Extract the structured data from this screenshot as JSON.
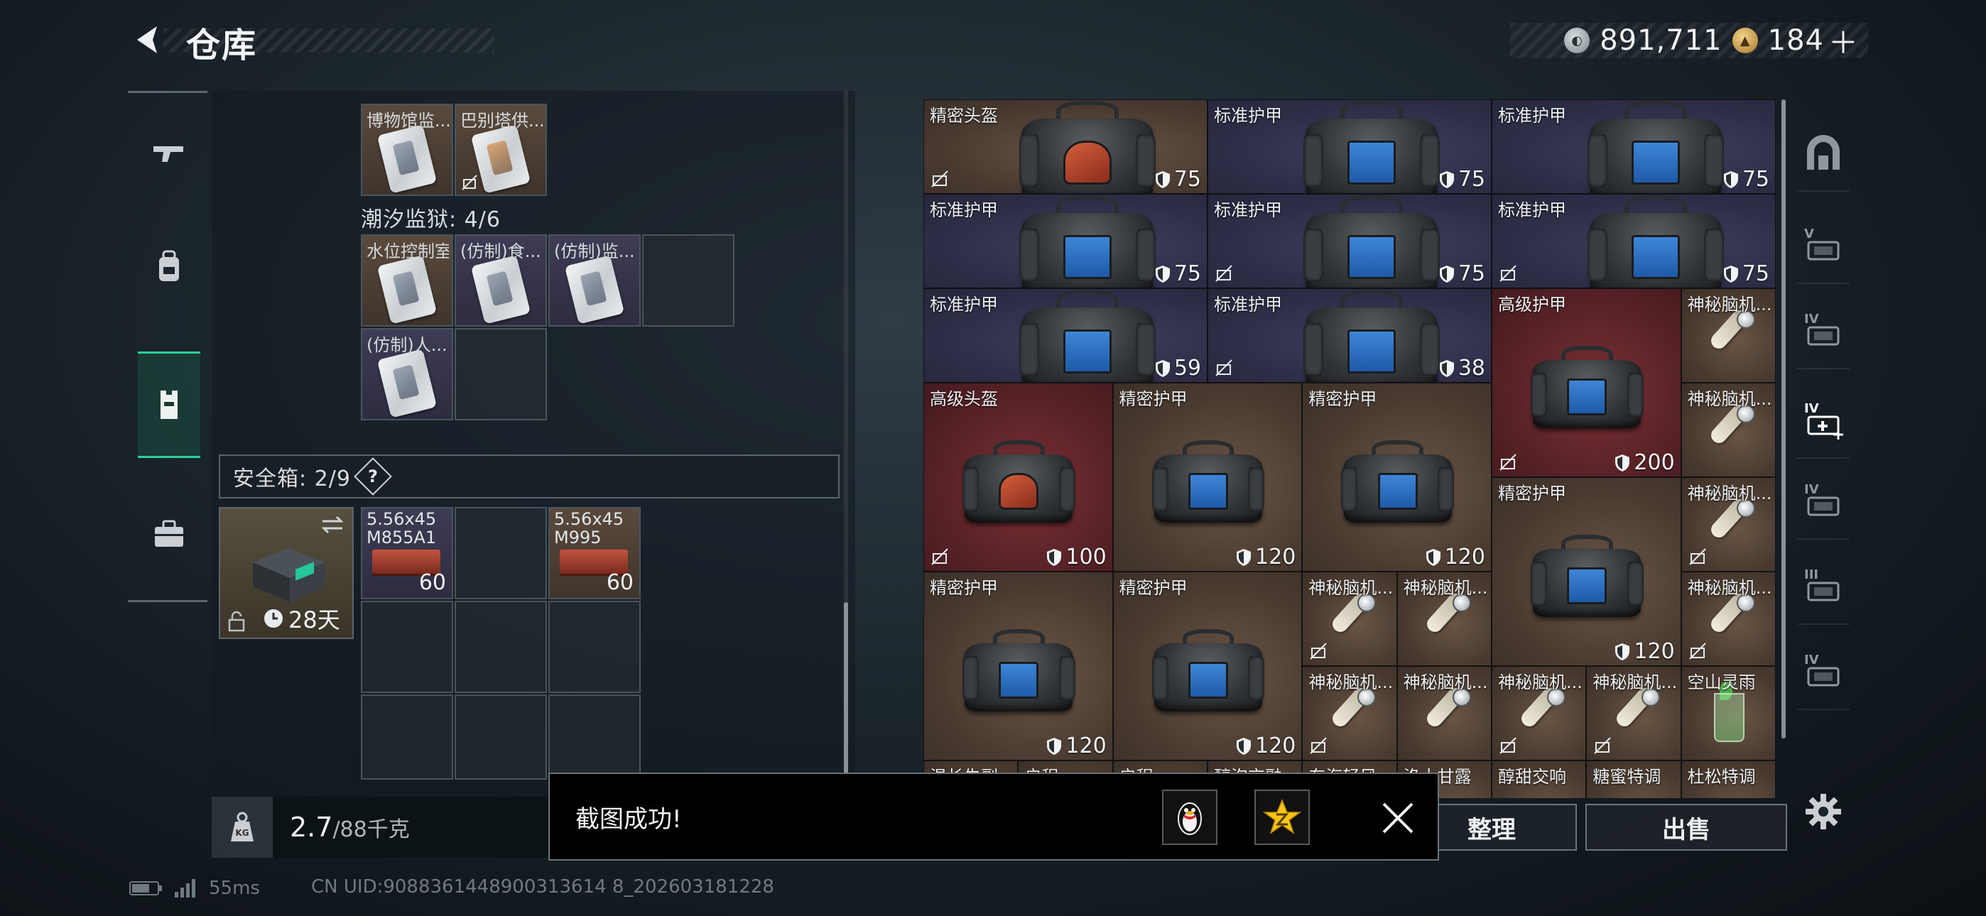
{
  "header": {
    "title": "仓库",
    "silver_amount": "891,711",
    "gold_amount": "184",
    "plus": "＋"
  },
  "left_nav": {
    "items": [
      {
        "icon": "pistol-icon"
      },
      {
        "icon": "backpack-icon"
      },
      {
        "icon": "vest-icon",
        "active": true
      },
      {
        "icon": "briefcase-icon"
      }
    ]
  },
  "collection": {
    "row0": [
      {
        "name": "博物馆监..."
      },
      {
        "name": "巴别塔供..."
      }
    ],
    "section_label": "潮汐监狱: 4/6",
    "row1": [
      {
        "name": "水位控制室"
      },
      {
        "name": "(仿制)食..."
      },
      {
        "name": "(仿制)监..."
      }
    ],
    "row2": [
      {
        "name": "(仿制)人..."
      }
    ]
  },
  "safebox": {
    "label": "安全箱: 2/9",
    "help": "?",
    "timer": "28天",
    "ammo": [
      {
        "line1": "5.56x45",
        "line2": "M855A1",
        "count": "60"
      },
      {
        "line1": "5.56x45",
        "line2": "M995",
        "count": "60"
      }
    ]
  },
  "weight": {
    "current": "2.7",
    "max": "/88千克",
    "icon_text": "KG"
  },
  "grid": {
    "items": [
      {
        "name": "精密头盔",
        "dur": "75"
      },
      {
        "name": "标准护甲",
        "dur": "75"
      },
      {
        "name": "标准护甲",
        "dur": "75"
      },
      {
        "name": "标准护甲",
        "dur": "75"
      },
      {
        "name": "标准护甲",
        "dur": "75"
      },
      {
        "name": "标准护甲",
        "dur": "75"
      },
      {
        "name": "标准护甲",
        "dur": "59"
      },
      {
        "name": "标准护甲",
        "dur": "38"
      },
      {
        "name": "高级护甲",
        "dur": "200"
      },
      {
        "name": "神秘脑机..."
      },
      {
        "name": "高级头盔",
        "dur": "100"
      },
      {
        "name": "精密护甲",
        "dur": "120"
      },
      {
        "name": "精密护甲",
        "dur": "120"
      },
      {
        "name": "神秘脑机..."
      },
      {
        "name": "精密护甲",
        "dur": "120"
      },
      {
        "name": "神秘脑机..."
      },
      {
        "name": "精密护甲",
        "dur": "120"
      },
      {
        "name": "精密护甲",
        "dur": "120"
      },
      {
        "name": "神秘脑机..."
      },
      {
        "name": "神秘脑机..."
      },
      {
        "name": "神秘脑机..."
      },
      {
        "name": "神秘脑机..."
      },
      {
        "name": "神秘脑机..."
      },
      {
        "name": "神秘脑机..."
      },
      {
        "name": "神秘脑机..."
      },
      {
        "name": "空山灵雨"
      },
      {
        "name": "温长失副"
      },
      {
        "name": "启程"
      },
      {
        "name": "启程"
      },
      {
        "name": "醇泡交融"
      },
      {
        "name": "东海轻风"
      },
      {
        "name": "洛十甘露"
      },
      {
        "name": "醇甜交响"
      },
      {
        "name": "糖蜜特调"
      },
      {
        "name": "杜松特调"
      }
    ]
  },
  "right_nav": {
    "items": [
      {
        "icon": "hideout-icon"
      },
      {
        "icon": "weapon-rack-v-icon",
        "level": "V"
      },
      {
        "icon": "storage-iv-icon",
        "level": "IV"
      },
      {
        "icon": "medical-iv-icon",
        "level": "IV",
        "active": true
      },
      {
        "icon": "medical-iv-dim-icon",
        "level": "IV"
      },
      {
        "icon": "workbench-iii-icon",
        "level": "III"
      },
      {
        "icon": "station-iv-icon",
        "level": "IV"
      }
    ]
  },
  "buttons": {
    "sort": "整理",
    "sell": "出售"
  },
  "toast": {
    "message": "截图成功!"
  },
  "status": {
    "ping": "55ms",
    "uid": "CN UID:9088361448900313614 8_202603181228"
  },
  "colors": {
    "accent_green": "#2bd09a",
    "slot_brown": "#4a3b31",
    "slot_navy": "#2e2e48",
    "slot_red": "#5a2328",
    "armor_blue": "#3e86d8"
  }
}
